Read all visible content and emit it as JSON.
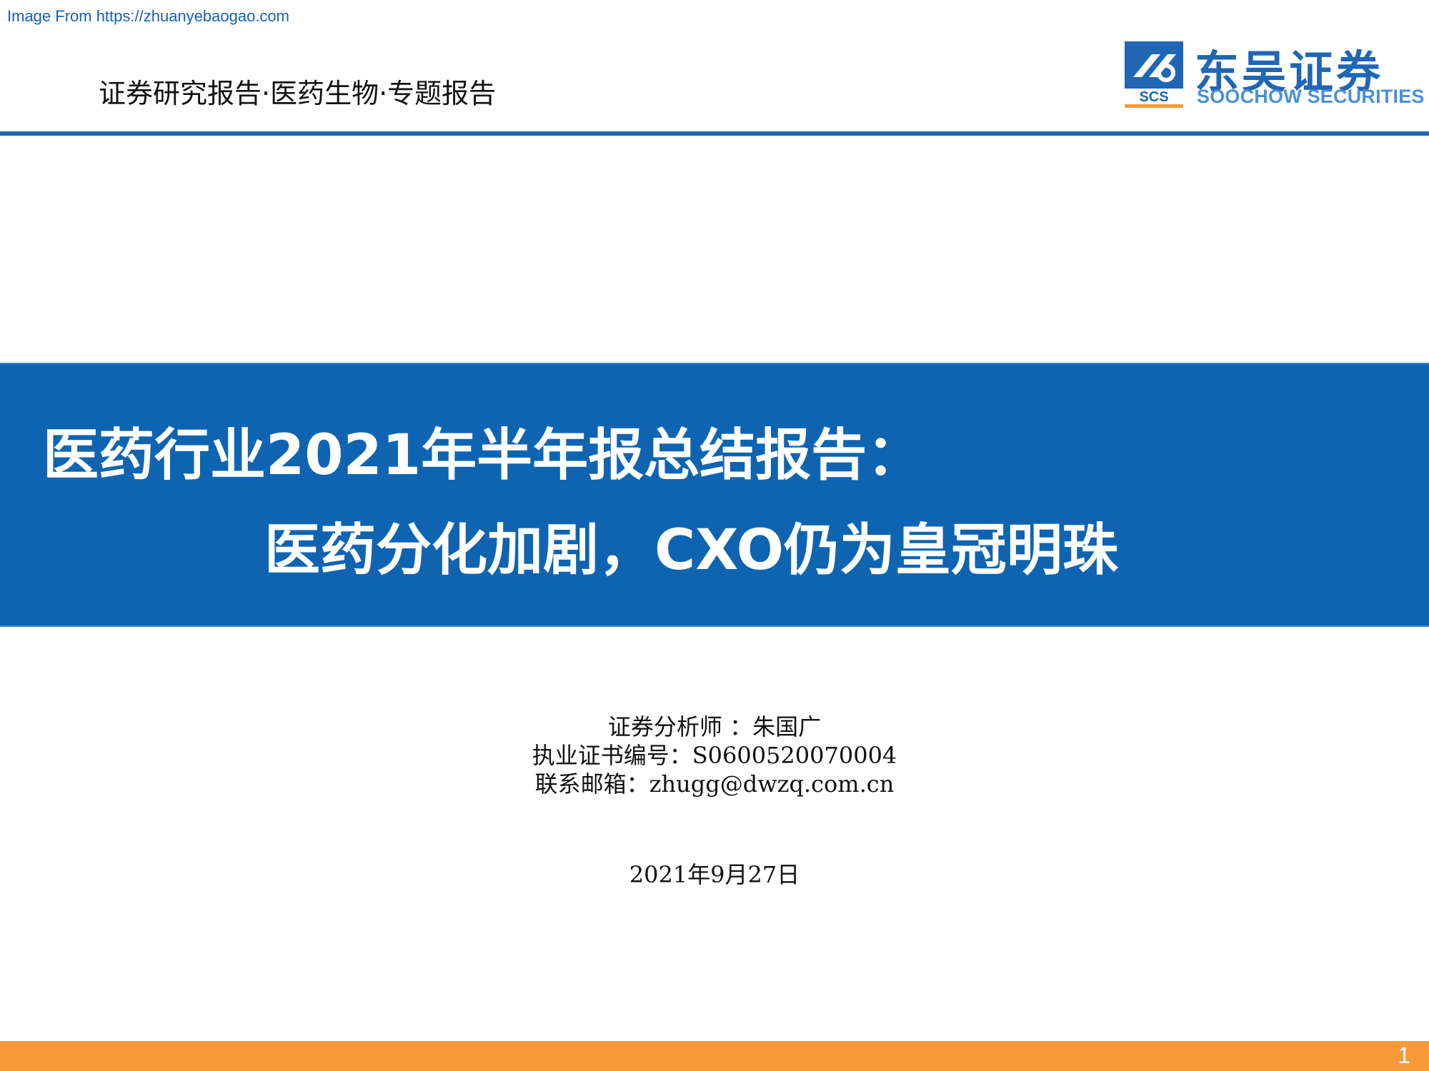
{
  "watermark": "Image From https://zhuanyebaogao.com",
  "header": {
    "report_type": "证券研究报告·医药生物·专题报告",
    "logo": {
      "mark_text": "SCS",
      "name_cn": "东吴证券",
      "name_en": "SOOCHOW SECURITIES"
    }
  },
  "title": {
    "line1": "医药行业2021年半年报总结报告：",
    "line2": "医药分化加剧，CXO仍为皇冠明珠"
  },
  "analyst": {
    "analyst_line": "证券分析师 ：朱国广",
    "license_line": "执业证书编号：S0600520070004",
    "email_line": "联系邮箱：zhugg@dwzq.com.cn"
  },
  "date": "2021年9月27日",
  "footer": {
    "page_number": "1"
  },
  "colors": {
    "brand_blue": "#0f64b2",
    "logo_blue": "#1f66b5",
    "footer_orange": "#f79a3a"
  }
}
